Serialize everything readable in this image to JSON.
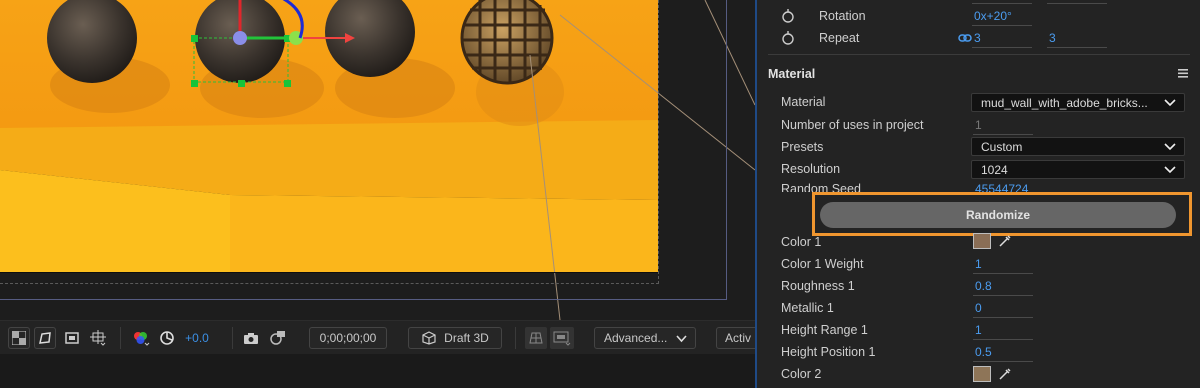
{
  "toolbar": {
    "exposure_value": "+0.0",
    "timecode": "0;00;00;00",
    "renderer_label": "Draft 3D",
    "advanced_label": "Advanced...",
    "active_label": "Activ"
  },
  "properties": {
    "rotation": {
      "label": "Rotation",
      "value": "0x+20°"
    },
    "repeat": {
      "label": "Repeat",
      "value_x": "3",
      "value_y": "3"
    }
  },
  "material_section": {
    "title": "Material",
    "material": {
      "label": "Material",
      "value": "mud_wall_with_adobe_bricks..."
    },
    "uses": {
      "label": "Number of uses in project",
      "value": "1"
    },
    "presets": {
      "label": "Presets",
      "value": "Custom"
    },
    "resolution": {
      "label": "Resolution",
      "value": "1024"
    },
    "random_seed": {
      "label": "Random Seed",
      "value": "45544724"
    },
    "randomize_button": "Randomize",
    "color1": {
      "label": "Color 1",
      "swatch": "#8a6e56"
    },
    "color1_weight": {
      "label": "Color 1 Weight",
      "value": "1"
    },
    "roughness1": {
      "label": "Roughness 1",
      "value": "0.8"
    },
    "metallic1": {
      "label": "Metallic 1",
      "value": "0"
    },
    "height_range1": {
      "label": "Height Range 1",
      "value": "1"
    },
    "height_position1": {
      "label": "Height Position 1",
      "value": "0.5"
    },
    "color2": {
      "label": "Color 2",
      "swatch": "#8e7558"
    }
  },
  "colors": {
    "highlight_orange": "#f0962f",
    "accent_blue": "#4b9cf0",
    "scene_orange": "#f4a21f"
  }
}
